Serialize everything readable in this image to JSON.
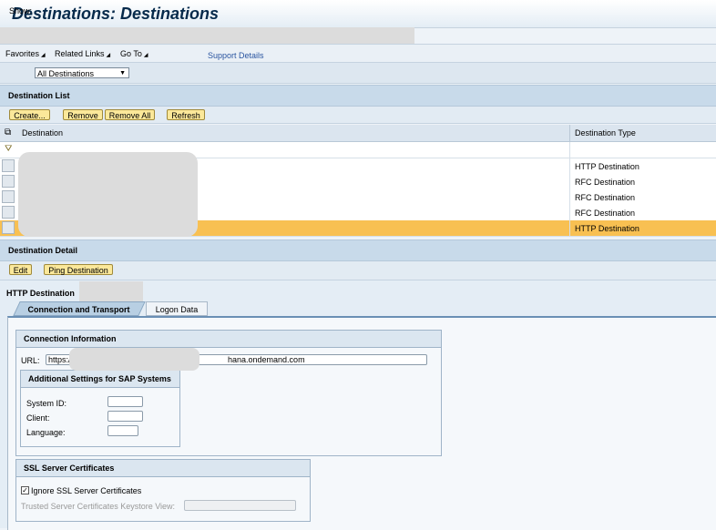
{
  "window": {
    "title": "Destinations: Destinations"
  },
  "menubar": {
    "favorites": "Favorites",
    "related_links": "Related Links",
    "go_to": "Go To",
    "support_details": "Support Details"
  },
  "show": {
    "label": "Show:",
    "selected": "All Destinations"
  },
  "destination_list": {
    "header": "Destination List",
    "buttons": {
      "create": "Create...",
      "remove": "Remove",
      "remove_all": "Remove All",
      "refresh": "Refresh"
    },
    "columns": {
      "destination": "Destination",
      "type": "Destination Type"
    },
    "rows": [
      {
        "type": "HTTP Destination"
      },
      {
        "type": "RFC Destination"
      },
      {
        "type": "RFC Destination"
      },
      {
        "type": "RFC Destination"
      },
      {
        "type": "HTTP Destination"
      }
    ]
  },
  "destination_detail": {
    "header": "Destination Detail",
    "buttons": {
      "edit": "Edit",
      "ping": "Ping Destination"
    },
    "kind_label": "HTTP Destination",
    "tabs": {
      "connection": "Connection and Transport",
      "logon": "Logon Data"
    },
    "connection_info": {
      "header": "Connection Information",
      "url_label": "URL:",
      "url_prefix": "https:/",
      "url_suffix": "hana.ondemand.com"
    },
    "sap_settings": {
      "header": "Additional Settings for SAP Systems",
      "system_id": "System ID:",
      "client": "Client:",
      "language": "Language:"
    },
    "ssl": {
      "header": "SSL Server Certificates",
      "ignore_label": "Ignore SSL Server Certificates",
      "ignore_checked": "✓",
      "keystore_label": "Trusted Server Certificates Keystore View:"
    }
  },
  "icons": {
    "settings": "table-settings-icon",
    "filter": "filter-icon",
    "dropdown": "chevron-down-icon"
  }
}
